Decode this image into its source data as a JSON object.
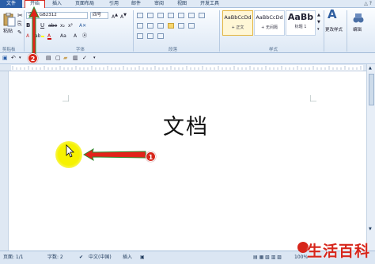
{
  "tabs": [
    "文件",
    "开始",
    "插入",
    "页面布局",
    "引用",
    "邮件",
    "审阅",
    "视图",
    "开发工具"
  ],
  "ribbon": {
    "paste_label": "粘贴",
    "clipboard_label": "剪贴板",
    "font_name": "宋体_GB2312",
    "font_size": "四号",
    "font_label": "字体",
    "paragraph_label": "段落",
    "styles": [
      {
        "sample": "AaBbCcDd",
        "name": "+ 正文",
        "active": true
      },
      {
        "sample": "AaBbCcDd",
        "name": "+ 无间隔",
        "active": false
      },
      {
        "sample": "AaBb",
        "name": "标题 1",
        "active": false
      }
    ],
    "styles_label": "样式",
    "change_styles_label": "更改样式",
    "edit_label": "编辑"
  },
  "document": {
    "title": "文档"
  },
  "annotations": {
    "badge_1": "1",
    "badge_2": "2"
  },
  "status": {
    "page": "页面: 1/1",
    "words": "字数: 2",
    "language": "中文(中国)",
    "mode": "插入",
    "zoom": "100%"
  },
  "watermark": "生活百科",
  "colors": {
    "file_tab": "#2a5ea8",
    "highlight_red": "#d7261b",
    "ribbon_bg": "#dde8f5",
    "spot_yellow": "#f6f200"
  }
}
